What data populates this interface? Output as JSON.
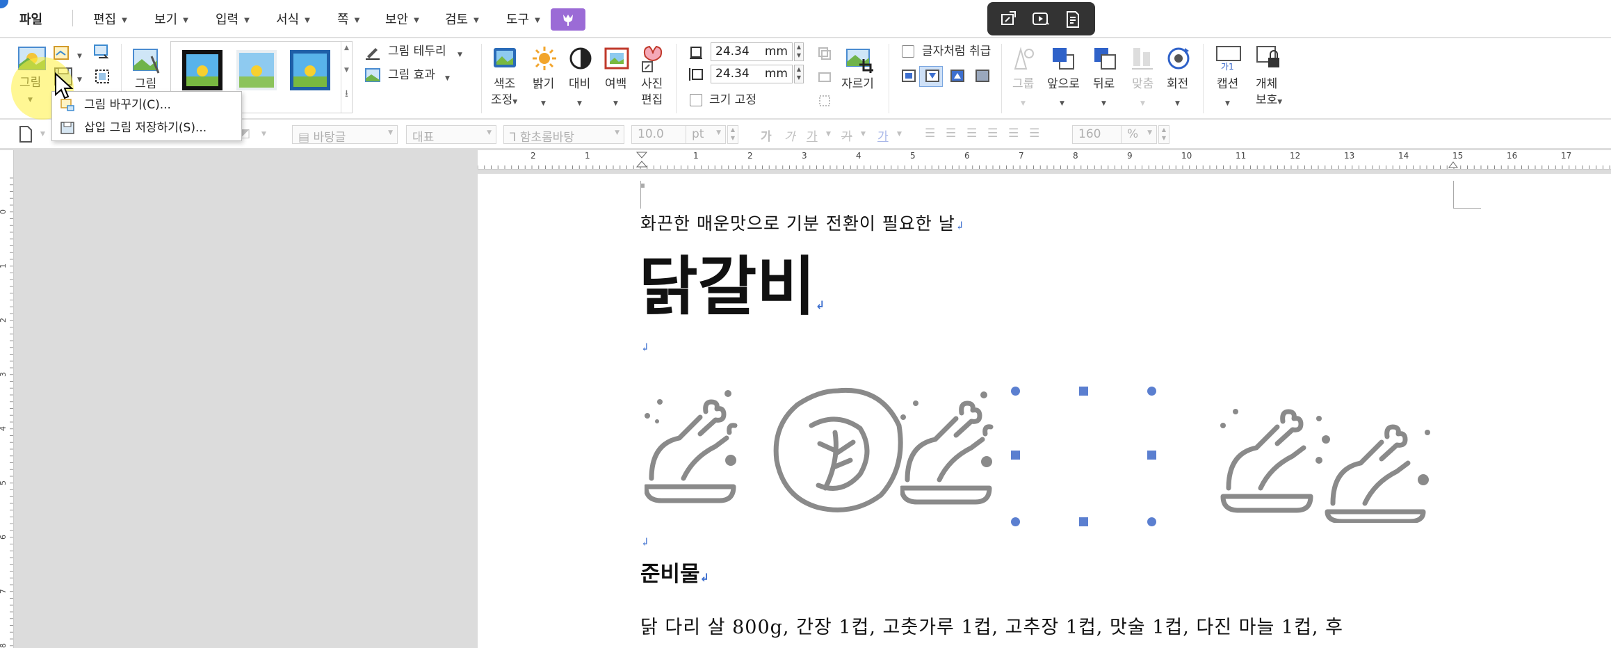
{
  "menu": {
    "file": "파일",
    "items": [
      "편집",
      "보기",
      "입력",
      "서식",
      "쪽",
      "보안",
      "검토",
      "도구"
    ]
  },
  "ribbon": {
    "picture_label": "그림",
    "picture2_label": "그림",
    "border_label": "그림 테두리",
    "effect_label": "그림 효과",
    "color_adjust_label": "색조\n조정",
    "color_adjust_line1": "색조",
    "color_adjust_line2": "조정",
    "brightness_label": "밝기",
    "contrast_label": "대비",
    "margin_label": "여백",
    "photo_edit_line1": "사진",
    "photo_edit_line2": "편집",
    "height_value": "24.34",
    "width_value": "24.34",
    "unit": "mm",
    "fix_size_label": "크기 고정",
    "crop_label": "자르기",
    "treat_as_char_label": "글자처럼 취급",
    "group_label": "그룹",
    "front_label": "앞으로",
    "back_label": "뒤로",
    "align_label": "맞춤",
    "rotate_label": "회전",
    "caption_label": "캡션",
    "object_protect_line1": "개체",
    "object_protect_line2": "보호",
    "caption_icon_text": "가1"
  },
  "dropdown": {
    "items": [
      "그림 바꾸기(C)...",
      "삽입 그림 저장하기(S)..."
    ]
  },
  "formatbar": {
    "style": "바탕글",
    "representative": "대표",
    "font": "함초롬바탕",
    "size": "10.0",
    "size_unit": "pt",
    "zoom": "160",
    "zoom_unit": "%"
  },
  "ruler": {
    "h_numbers": [
      "2",
      "1",
      "1",
      "2",
      "3",
      "4",
      "5",
      "6",
      "7",
      "8",
      "9",
      "10",
      "11",
      "12",
      "13",
      "14",
      "15",
      "16",
      "17"
    ],
    "v_numbers": [
      "0",
      "1",
      "2",
      "3",
      "4",
      "5",
      "6",
      "7",
      "8"
    ]
  },
  "document": {
    "subtitle": "화끈한 매운맛으로 기분 전환이 필요한 날",
    "title": "닭갈비",
    "section_heading": "준비물",
    "ingredients": "닭 다리 살 800g, 간장 1컵, 고춧가루 1컵, 고추장 1컵, 맛술 1컵, 다진 마늘 1컵, 후"
  },
  "colors": {
    "accent_purple": "#9b6bd6",
    "selection_handle": "#5b7fd0",
    "icon_gray": "#8a8a8a",
    "paragraph_mark": "#3d6fcf"
  }
}
